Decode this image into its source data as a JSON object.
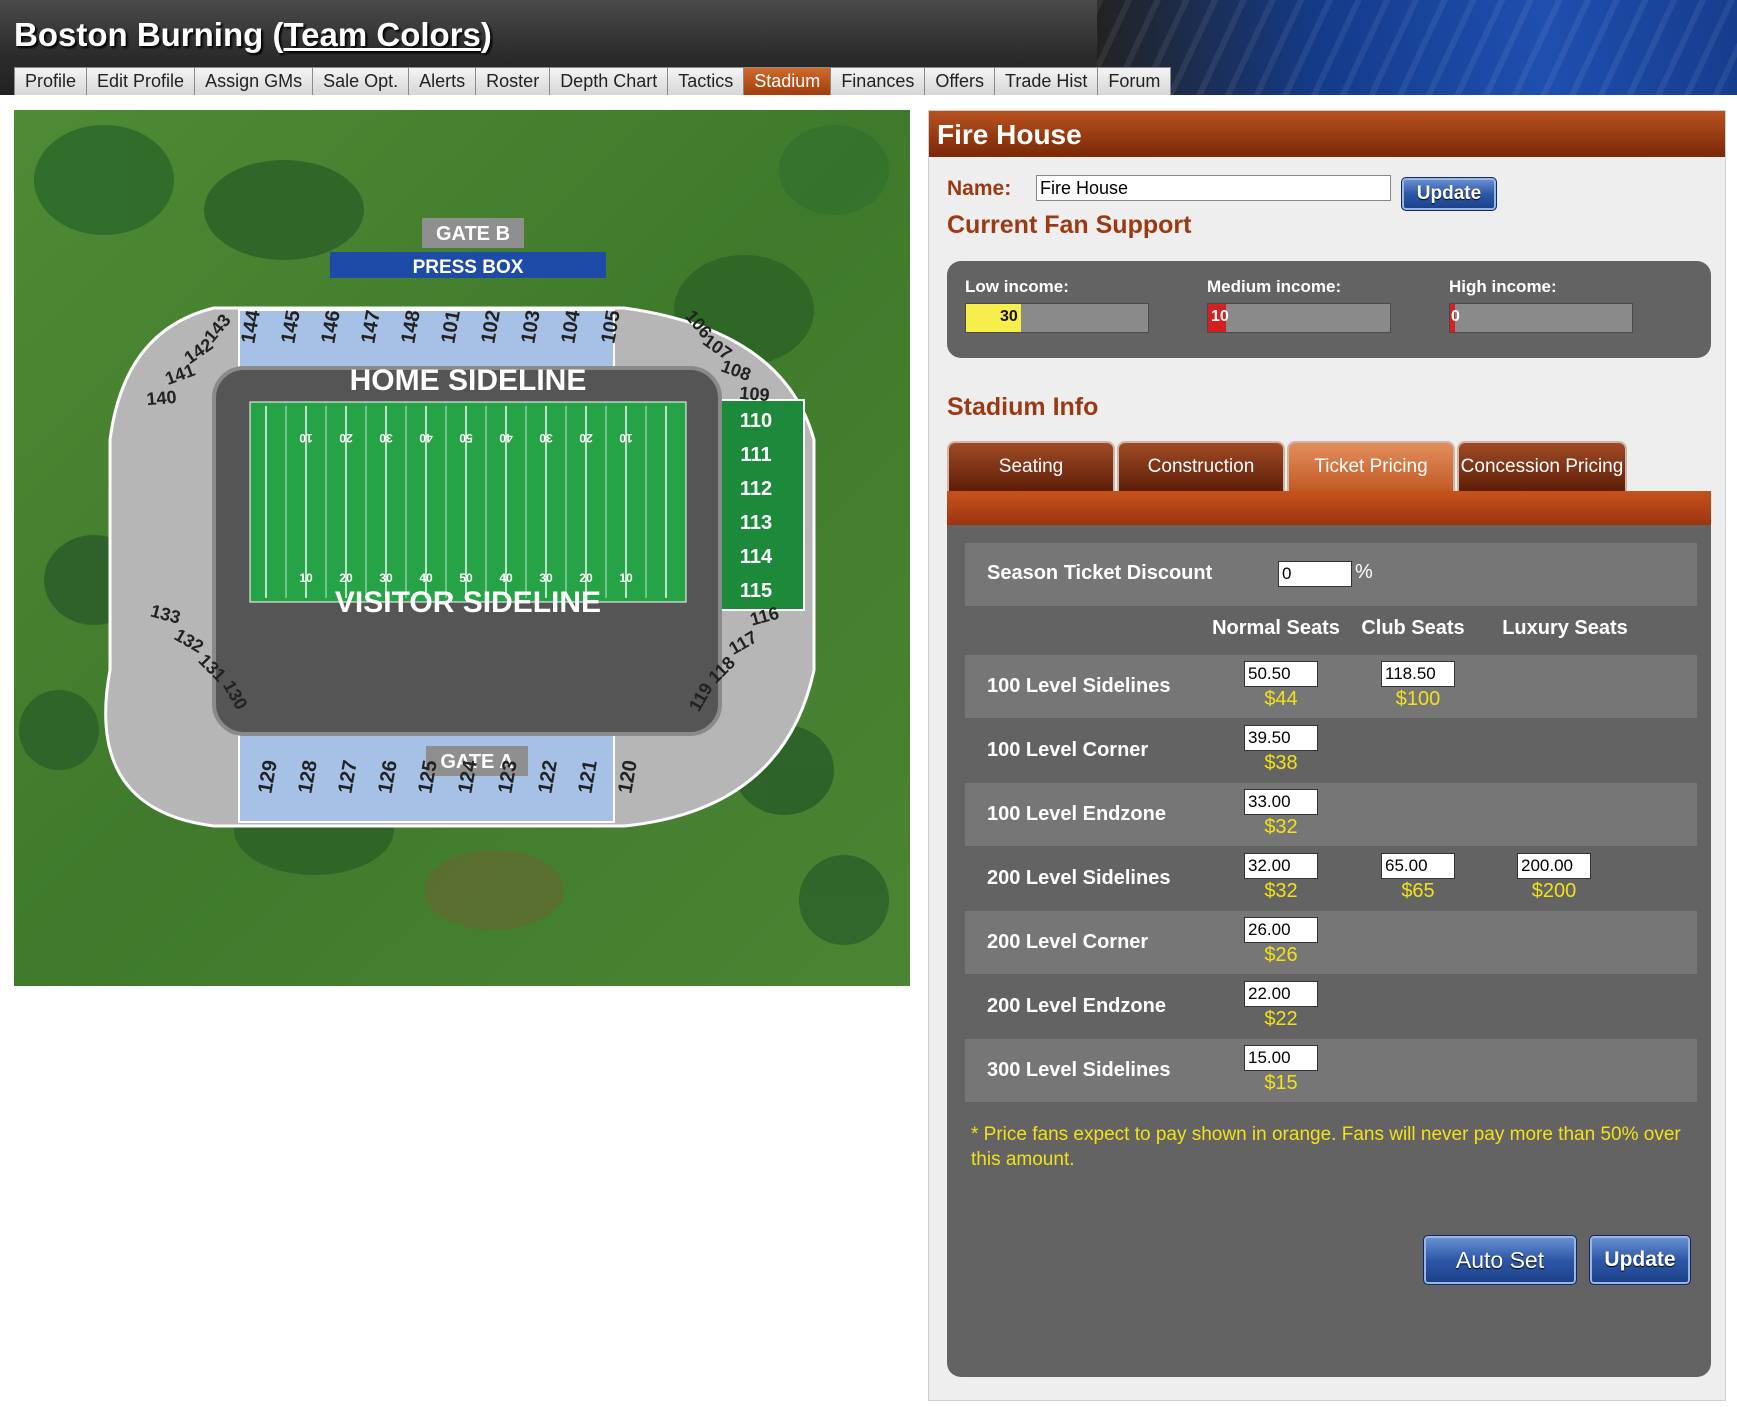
{
  "header": {
    "team_name": "Boston Burning",
    "team_colors_link": "Team Colors"
  },
  "nav": {
    "tabs": [
      "Profile",
      "Edit Profile",
      "Assign GMs",
      "Sale Opt.",
      "Alerts",
      "Roster",
      "Depth Chart",
      "Tactics",
      "Stadium",
      "Finances",
      "Offers",
      "Trade Hist",
      "Forum"
    ],
    "active": "Stadium"
  },
  "map": {
    "gate_b": "GATE B",
    "gate_a": "GATE A",
    "press_box": "PRESS BOX",
    "home_sideline": "HOME SIDELINE",
    "visitor_sideline": "VISITOR SIDELINE",
    "top_sections": [
      "144",
      "145",
      "146",
      "147",
      "148",
      "101",
      "102",
      "103",
      "104",
      "105"
    ],
    "bottom_sections": [
      "129",
      "128",
      "127",
      "126",
      "125",
      "124",
      "123",
      "122",
      "121",
      "120"
    ],
    "right_green_sections": [
      "110",
      "111",
      "112",
      "113",
      "114",
      "115"
    ],
    "top_left_corner_sections": [
      "143",
      "142",
      "141",
      "140"
    ],
    "top_right_corner_sections": [
      "106",
      "107",
      "108",
      "109"
    ],
    "bottom_left_corner_sections": [
      "133",
      "132",
      "131",
      "130"
    ],
    "bottom_right_corner_sections": [
      "116",
      "117",
      "118",
      "119"
    ],
    "field_yard_numbers": [
      "10",
      "20",
      "30",
      "40",
      "50",
      "40",
      "30",
      "20",
      "10"
    ]
  },
  "stadium": {
    "name": "Fire House",
    "name_label": "Name:",
    "name_value": "Fire House",
    "update_label": "Update"
  },
  "fan_support": {
    "heading": "Current Fan Support",
    "levels": [
      {
        "label": "Low income:",
        "value": "30",
        "fraction": 0.3,
        "color": "#f6ee4a"
      },
      {
        "label": "Medium income:",
        "value": "10",
        "fraction": 0.1,
        "color": "#d42020"
      },
      {
        "label": "High income:",
        "value": "0",
        "fraction": 0.03,
        "color": "#d42020"
      }
    ]
  },
  "stadium_info": {
    "heading": "Stadium Info",
    "tabs": [
      "Seating",
      "Construction",
      "Ticket Pricing",
      "Concession Pricing"
    ],
    "active_tab": "Ticket Pricing",
    "season_discount_label": "Season Ticket Discount",
    "season_discount_value": "0",
    "percent_sign": "%",
    "columns": [
      "Normal Seats",
      "Club Seats",
      "Luxury Seats"
    ],
    "rows": [
      {
        "label": "100 Level Sidelines",
        "normal": "50.50",
        "normal_exp": "$44",
        "club": "118.50",
        "club_exp": "$100",
        "luxury": null,
        "luxury_exp": null
      },
      {
        "label": "100 Level Corner",
        "normal": "39.50",
        "normal_exp": "$38",
        "club": null,
        "club_exp": null,
        "luxury": null,
        "luxury_exp": null
      },
      {
        "label": "100 Level Endzone",
        "normal": "33.00",
        "normal_exp": "$32",
        "club": null,
        "club_exp": null,
        "luxury": null,
        "luxury_exp": null
      },
      {
        "label": "200 Level Sidelines",
        "normal": "32.00",
        "normal_exp": "$32",
        "club": "65.00",
        "club_exp": "$65",
        "luxury": "200.00",
        "luxury_exp": "$200"
      },
      {
        "label": "200 Level Corner",
        "normal": "26.00",
        "normal_exp": "$26",
        "club": null,
        "club_exp": null,
        "luxury": null,
        "luxury_exp": null
      },
      {
        "label": "200 Level Endzone",
        "normal": "22.00",
        "normal_exp": "$22",
        "club": null,
        "club_exp": null,
        "luxury": null,
        "luxury_exp": null
      },
      {
        "label": "300 Level Sidelines",
        "normal": "15.00",
        "normal_exp": "$15",
        "club": null,
        "club_exp": null,
        "luxury": null,
        "luxury_exp": null
      }
    ],
    "note": "* Price fans expect to pay shown in orange. Fans will never pay more than 50% over this amount.",
    "auto_set_label": "Auto Set",
    "update_label": "Update"
  }
}
